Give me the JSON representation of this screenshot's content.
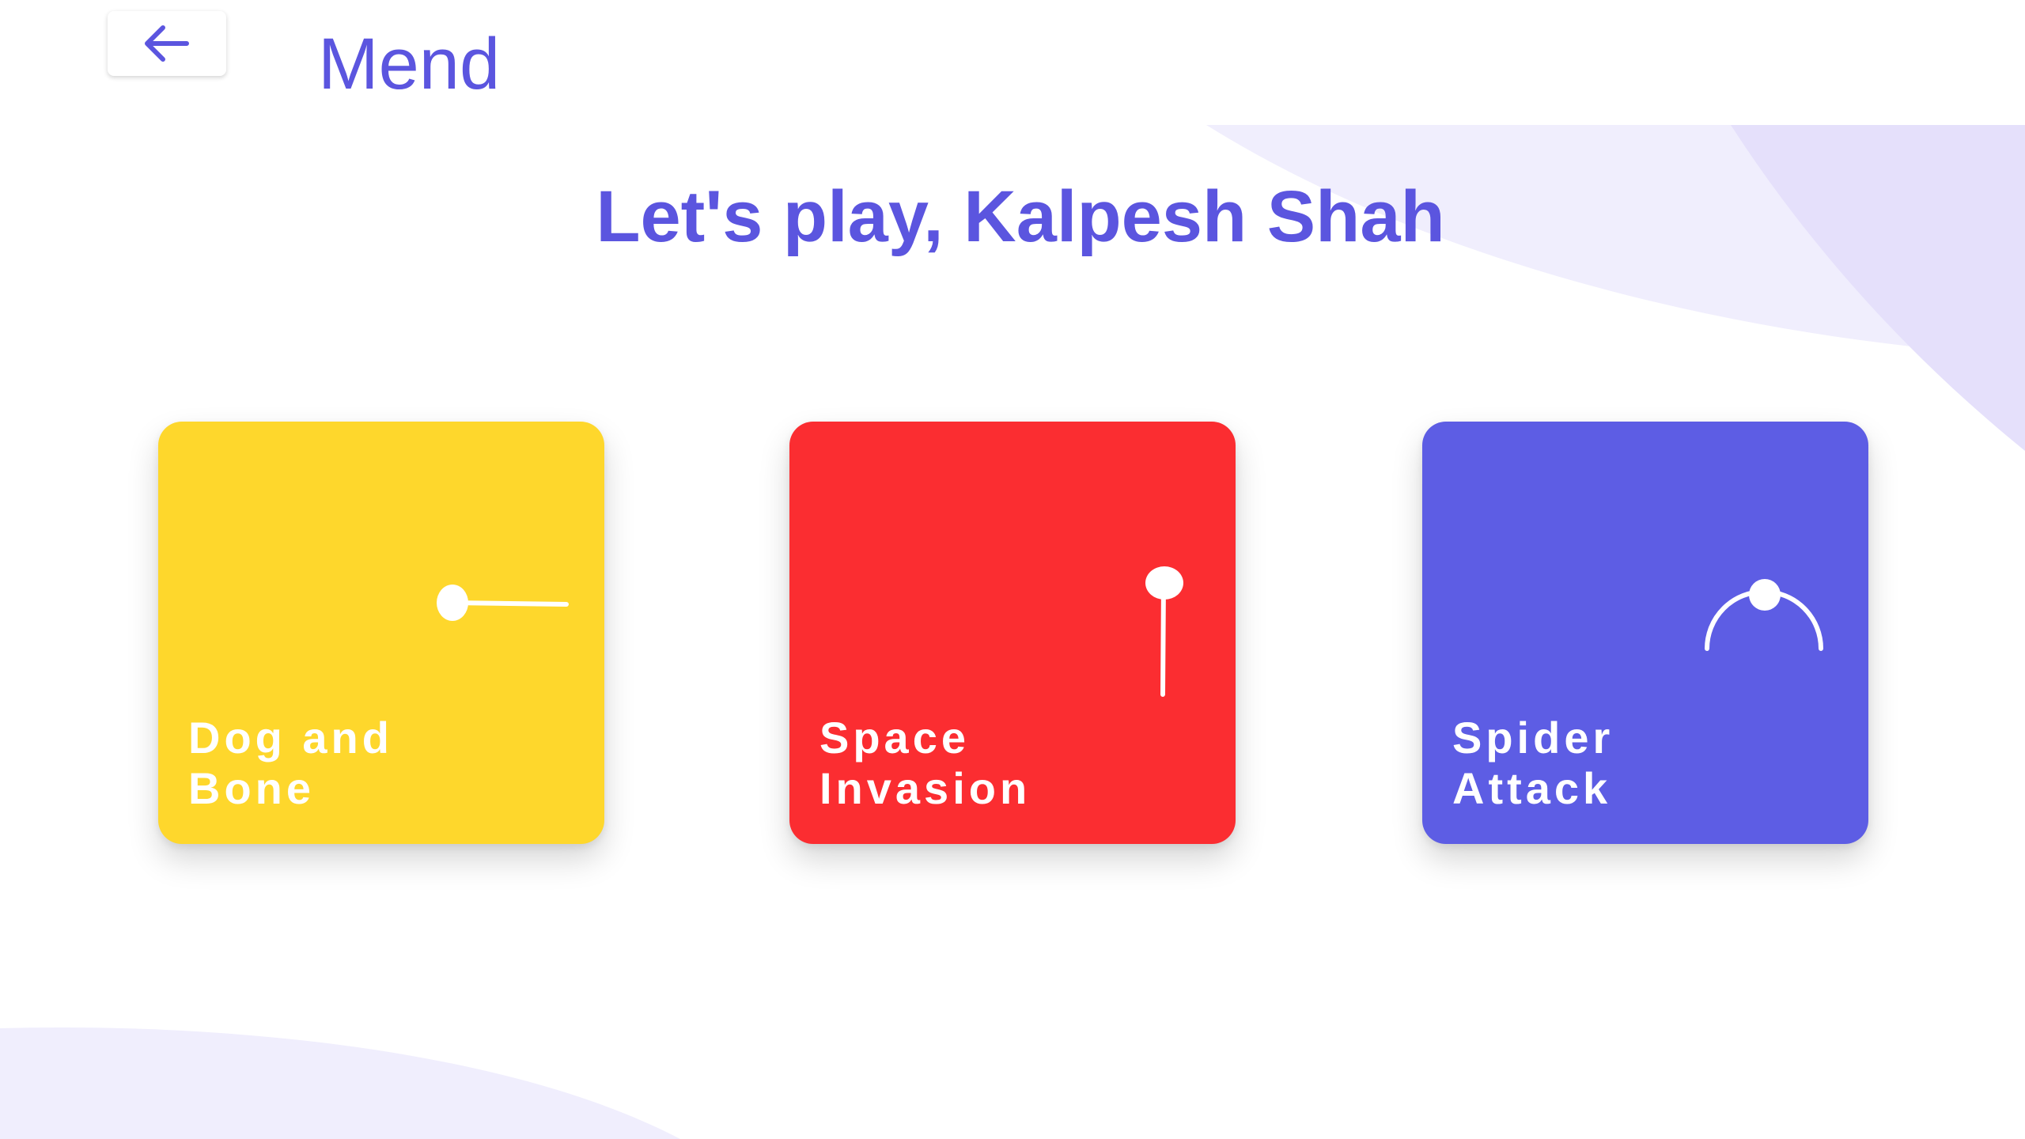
{
  "header": {
    "back_icon": "arrow-left-icon",
    "title": "Mend"
  },
  "greeting": "Let's play, Kalpesh Shah",
  "games": [
    {
      "line1": "Dog and",
      "line2": "Bone",
      "color": "#fed72c",
      "icon": "horizontal-pin-icon"
    },
    {
      "line1": "Space",
      "line2": "Invasion",
      "color": "#fb2d31",
      "icon": "vertical-pin-icon"
    },
    {
      "line1": "Spider",
      "line2": "Attack",
      "color": "#5d5de4",
      "icon": "arc-pin-icon"
    }
  ],
  "colors": {
    "accent": "#5b55df",
    "bg_blob_light": "#f0eefd",
    "bg_blob_mid": "#e5e0fb"
  }
}
